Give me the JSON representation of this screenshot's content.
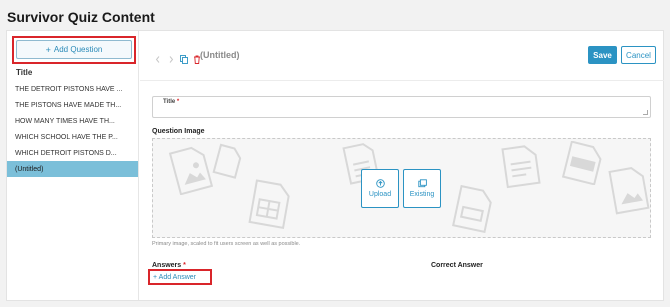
{
  "page": {
    "title": "Survivor Quiz Content"
  },
  "sidebar": {
    "add_question_label": "Add Question",
    "header": "Title",
    "items": [
      {
        "label": "THE DETROIT PISTONS HAVE ..."
      },
      {
        "label": "THE PISTONS HAVE MADE TH..."
      },
      {
        "label": "HOW MANY TIMES HAVE TH..."
      },
      {
        "label": "WHICH SCHOOL HAVE THE P..."
      },
      {
        "label": "WHICH DETROIT PISTONS D..."
      },
      {
        "label": "(Untitled)",
        "active": true
      }
    ]
  },
  "toolbar": {
    "question_name": "(Untitled)",
    "save_label": "Save",
    "cancel_label": "Cancel",
    "icons": [
      "chevron-left-icon",
      "chevron-right-icon",
      "copy-icon",
      "trash-icon"
    ]
  },
  "form": {
    "title_label": "Title",
    "required_mark": "*",
    "question_image_label": "Question Image",
    "upload_label": "Upload",
    "existing_label": "Existing",
    "image_hint": "Primary image, scaled to fit users screen as well as possible.",
    "answers_label": "Answers",
    "correct_answer_label": "Correct Answer",
    "add_answer_label": "+ Add Answer"
  },
  "colors": {
    "accent": "#2b93c3",
    "highlight": "#d9252a",
    "active_row": "#7bbfd9",
    "delete": "#d9252a"
  }
}
